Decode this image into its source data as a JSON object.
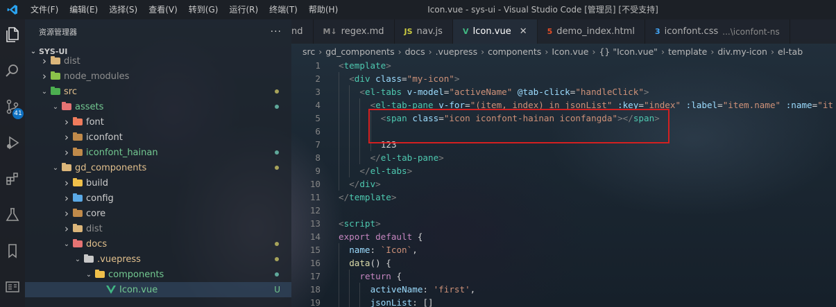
{
  "titlebar": {
    "menu": [
      "文件(F)",
      "编辑(E)",
      "选择(S)",
      "查看(V)",
      "转到(G)",
      "运行(R)",
      "终端(T)",
      "帮助(H)"
    ],
    "window_title": "Icon.vue - sys-ui - Visual Studio Code [管理员] [不受支持]"
  },
  "activity_bar": {
    "icons": [
      "explorer-icon",
      "search-icon",
      "source-control-icon",
      "run-debug-icon",
      "extensions-icon",
      "testing-icon",
      "bookmarks-icon",
      "remote-explorer-icon"
    ],
    "scm_badge": "41"
  },
  "sidebar": {
    "title": "资源管理器",
    "more": "···",
    "section": "SYS-UI",
    "tree": [
      {
        "label": "dist",
        "depth": 1,
        "expanded": false,
        "icon_color": "#dcb67a",
        "text_color": "#8f8f8f",
        "marker": ""
      },
      {
        "label": "node_modules",
        "depth": 1,
        "expanded": false,
        "icon_color": "#8bc34a",
        "text_color": "#8f8f8f",
        "marker": ""
      },
      {
        "label": "src",
        "depth": 1,
        "expanded": true,
        "icon_color": "#4caf50",
        "text_color": "#e2c08d",
        "marker": "dot-olive"
      },
      {
        "label": "assets",
        "depth": 2,
        "expanded": true,
        "icon_color": "#e57373",
        "text_color": "#73c991",
        "marker": "dot-teal"
      },
      {
        "label": "font",
        "depth": 3,
        "expanded": false,
        "icon_color": "#ef7b5c",
        "text_color": "#cccccc",
        "marker": ""
      },
      {
        "label": "iconfont",
        "depth": 3,
        "expanded": false,
        "icon_color": "#c08a4a",
        "text_color": "#cccccc",
        "marker": ""
      },
      {
        "label": "iconfont_hainan",
        "depth": 3,
        "expanded": false,
        "icon_color": "#c08a4a",
        "text_color": "#73c991",
        "marker": "dot-teal"
      },
      {
        "label": "gd_components",
        "depth": 2,
        "expanded": true,
        "icon_color": "#dcb67a",
        "text_color": "#e2c08d",
        "marker": "dot-olive"
      },
      {
        "label": "build",
        "depth": 3,
        "expanded": false,
        "icon_color": "#f0c04a",
        "text_color": "#cccccc",
        "marker": ""
      },
      {
        "label": "config",
        "depth": 3,
        "expanded": false,
        "icon_color": "#5aa9e6",
        "text_color": "#cccccc",
        "marker": ""
      },
      {
        "label": "core",
        "depth": 3,
        "expanded": false,
        "icon_color": "#c08a4a",
        "text_color": "#cccccc",
        "marker": ""
      },
      {
        "label": "dist",
        "depth": 3,
        "expanded": false,
        "icon_color": "#dcb67a",
        "text_color": "#8f8f8f",
        "marker": ""
      },
      {
        "label": "docs",
        "depth": 3,
        "expanded": true,
        "icon_color": "#e57373",
        "text_color": "#e2c08d",
        "marker": "dot-olive"
      },
      {
        "label": ".vuepress",
        "depth": 4,
        "expanded": true,
        "icon_color": "#c8c8c8",
        "text_color": "#e2c08d",
        "marker": "dot-olive"
      },
      {
        "label": "components",
        "depth": 5,
        "expanded": true,
        "icon_color": "#f0c04a",
        "text_color": "#73c991",
        "marker": "dot-teal"
      },
      {
        "label": "Icon.vue",
        "depth": 6,
        "expanded": null,
        "icon_color": "#41b883",
        "text_color": "#73c991",
        "marker": "U",
        "selected": true
      }
    ]
  },
  "tabs": [
    {
      "label": "nd",
      "icon": "",
      "icon_color": "#519aba",
      "desc": "",
      "active": false
    },
    {
      "label": "regex.md",
      "icon": "M↓",
      "icon_color": "#8a8a8a",
      "desc": "",
      "active": false
    },
    {
      "label": "nav.js",
      "icon": "JS",
      "icon_color": "#cbcb41",
      "desc": "",
      "active": false
    },
    {
      "label": "Icon.vue",
      "icon": "V",
      "icon_color": "#41b883",
      "desc": "",
      "active": true
    },
    {
      "label": "demo_index.html",
      "icon": "5",
      "icon_color": "#e44d26",
      "desc": "",
      "active": false
    },
    {
      "label": "iconfont.css",
      "icon": "3",
      "icon_color": "#42a5f5",
      "desc": "...\\iconfont-ns",
      "active": false
    }
  ],
  "breadcrumb": [
    "src",
    "gd_components",
    "docs",
    ".vuepress",
    "components",
    "Icon.vue",
    "{} \"Icon.vue\"",
    "template",
    "div.my-icon",
    "el-tab"
  ],
  "editor": {
    "lines": [
      {
        "n": "1",
        "indent": 0,
        "tokens": [
          [
            "br",
            "<"
          ],
          [
            "tag",
            "template"
          ],
          [
            "br",
            ">"
          ]
        ]
      },
      {
        "n": "2",
        "indent": 1,
        "tokens": [
          [
            "br",
            "<"
          ],
          [
            "tag",
            "div"
          ],
          [
            "txt",
            " "
          ],
          [
            "attr",
            "class"
          ],
          [
            "txt",
            "="
          ],
          [
            "str",
            "\"my-icon\""
          ],
          [
            "br",
            ">"
          ]
        ]
      },
      {
        "n": "3",
        "indent": 2,
        "tokens": [
          [
            "br",
            "<"
          ],
          [
            "tag",
            "el-tabs"
          ],
          [
            "txt",
            " "
          ],
          [
            "attr",
            "v-model"
          ],
          [
            "txt",
            "="
          ],
          [
            "str",
            "\"activeName\""
          ],
          [
            "txt",
            " "
          ],
          [
            "attr",
            "@tab-click"
          ],
          [
            "txt",
            "="
          ],
          [
            "str",
            "\"handleClick\""
          ],
          [
            "br",
            ">"
          ]
        ]
      },
      {
        "n": "4",
        "indent": 3,
        "tokens": [
          [
            "br",
            "<"
          ],
          [
            "tag",
            "el-tab-pane"
          ],
          [
            "txt",
            " "
          ],
          [
            "attr",
            "v-for"
          ],
          [
            "txt",
            "="
          ],
          [
            "str",
            "\"(item, index) in jsonList\""
          ],
          [
            "txt",
            " "
          ],
          [
            "attr",
            ":key"
          ],
          [
            "txt",
            "="
          ],
          [
            "str",
            "\"index\""
          ],
          [
            "txt",
            " "
          ],
          [
            "attr",
            ":label"
          ],
          [
            "txt",
            "="
          ],
          [
            "str",
            "\"item.name\""
          ],
          [
            "txt",
            " "
          ],
          [
            "attr",
            ":name"
          ],
          [
            "txt",
            "="
          ],
          [
            "str",
            "\"it"
          ]
        ]
      },
      {
        "n": "5",
        "indent": 4,
        "tokens": [
          [
            "br",
            "<"
          ],
          [
            "tag",
            "span"
          ],
          [
            "txt",
            " "
          ],
          [
            "attr",
            "class"
          ],
          [
            "txt",
            "="
          ],
          [
            "str",
            "\"icon iconfont-hainan iconfangda\""
          ],
          [
            "br",
            ">"
          ],
          [
            "br",
            "</"
          ],
          [
            "tag",
            "span"
          ],
          [
            "br",
            ">"
          ]
        ]
      },
      {
        "n": "6",
        "indent": 4,
        "tokens": []
      },
      {
        "n": "7",
        "indent": 4,
        "tokens": [
          [
            "txt",
            "123"
          ]
        ]
      },
      {
        "n": "8",
        "indent": 3,
        "tokens": [
          [
            "br",
            "</"
          ],
          [
            "tag",
            "el-tab-pane"
          ],
          [
            "br",
            ">"
          ]
        ]
      },
      {
        "n": "9",
        "indent": 2,
        "tokens": [
          [
            "br",
            "</"
          ],
          [
            "tag",
            "el-tabs"
          ],
          [
            "br",
            ">"
          ]
        ]
      },
      {
        "n": "10",
        "indent": 1,
        "tokens": [
          [
            "br",
            "</"
          ],
          [
            "tag",
            "div"
          ],
          [
            "br",
            ">"
          ]
        ]
      },
      {
        "n": "11",
        "indent": 0,
        "tokens": [
          [
            "br",
            "</"
          ],
          [
            "tag",
            "template"
          ],
          [
            "br",
            ">"
          ]
        ]
      },
      {
        "n": "12",
        "indent": 0,
        "tokens": []
      },
      {
        "n": "13",
        "indent": 0,
        "tokens": [
          [
            "br",
            "<"
          ],
          [
            "tag",
            "script"
          ],
          [
            "br",
            ">"
          ]
        ]
      },
      {
        "n": "14",
        "indent": 0,
        "tokens": [
          [
            "kw",
            "export"
          ],
          [
            "txt",
            " "
          ],
          [
            "kw",
            "default"
          ],
          [
            "txt",
            " {"
          ]
        ]
      },
      {
        "n": "15",
        "indent": 1,
        "tokens": [
          [
            "attr",
            "name"
          ],
          [
            "txt",
            ": "
          ],
          [
            "str",
            "`Icon`"
          ],
          [
            "txt",
            ","
          ]
        ]
      },
      {
        "n": "16",
        "indent": 1,
        "tokens": [
          [
            "fn",
            "data"
          ],
          [
            "txt",
            "() {"
          ]
        ]
      },
      {
        "n": "17",
        "indent": 2,
        "tokens": [
          [
            "kw",
            "return"
          ],
          [
            "txt",
            " {"
          ]
        ]
      },
      {
        "n": "18",
        "indent": 3,
        "tokens": [
          [
            "attr",
            "activeName"
          ],
          [
            "txt",
            ": "
          ],
          [
            "str",
            "'first'"
          ],
          [
            "txt",
            ","
          ]
        ]
      },
      {
        "n": "19",
        "indent": 3,
        "tokens": [
          [
            "attr",
            "jsonList"
          ],
          [
            "txt",
            ": []"
          ]
        ]
      }
    ]
  },
  "colors": {
    "accent": "#0e70c0",
    "highlight_box": "#d42020",
    "git_modified_dot": "#a7a35a",
    "git_untracked_dot": "#5fa89a"
  }
}
